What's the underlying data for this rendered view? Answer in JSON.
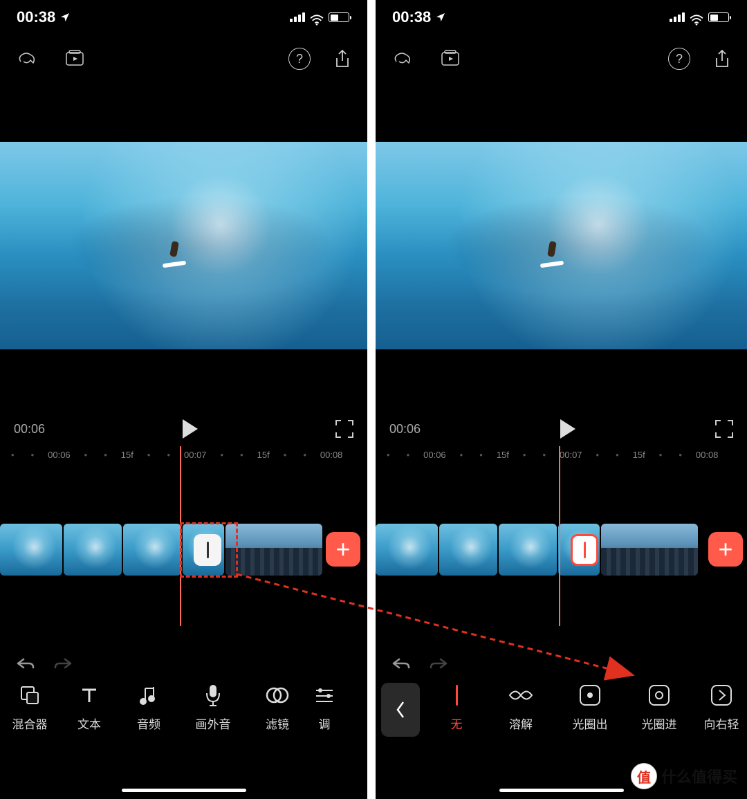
{
  "status": {
    "time": "00:38"
  },
  "preview": {
    "time_left": "00:06"
  },
  "ruler": {
    "t1": "00:06",
    "f1": "15f",
    "t2": "00:07",
    "f2": "15f",
    "t3": "00:08"
  },
  "left_tools": [
    {
      "id": "mixer",
      "label": "混合器"
    },
    {
      "id": "text",
      "label": "文本"
    },
    {
      "id": "audio",
      "label": "音频"
    },
    {
      "id": "voiceover",
      "label": "画外音"
    },
    {
      "id": "filter",
      "label": "滤镜"
    },
    {
      "id": "adjust",
      "label": "调"
    }
  ],
  "right_tools": [
    {
      "id": "none",
      "label": "无"
    },
    {
      "id": "dissolve",
      "label": "溶解"
    },
    {
      "id": "iris-out",
      "label": "光圈出"
    },
    {
      "id": "iris-in",
      "label": "光圈进"
    },
    {
      "id": "wipe-right",
      "label": "向右轻"
    }
  ],
  "watermark": {
    "badge": "值",
    "text": "什么值得买"
  }
}
